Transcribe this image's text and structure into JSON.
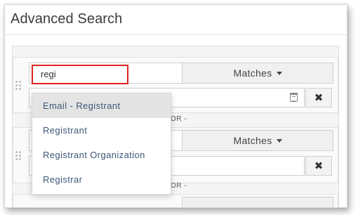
{
  "window": {
    "title": "Advanced Search"
  },
  "search": {
    "value": "regi"
  },
  "operators": {
    "row1": {
      "label": "Matches"
    },
    "row2": {
      "label": "Matches"
    }
  },
  "separators": [
    "OR -",
    "OR -"
  ],
  "dropdown": {
    "items": [
      {
        "label": "Email - Registrant",
        "highlighted": true
      },
      {
        "label": "Registrant"
      },
      {
        "label": "Registrant Organization"
      },
      {
        "label": "Registrar"
      }
    ]
  },
  "icons": {
    "calendar": "calendar-icon",
    "remove": "close-icon",
    "drag": "drag-handle-icon",
    "caret": "caret-down-icon"
  },
  "colors": {
    "highlight_border": "#e02020",
    "link_text": "#3d5676",
    "active_item_bg": "#e4e4e4"
  },
  "remove_glyph": "✖"
}
